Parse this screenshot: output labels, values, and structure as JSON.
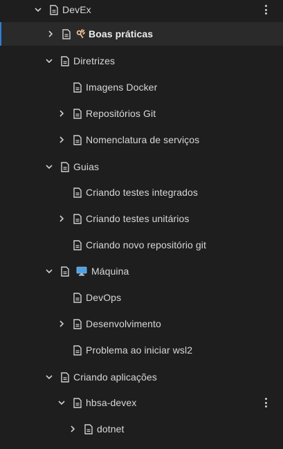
{
  "tree": {
    "items": [
      {
        "label": "DevEx",
        "expanded": true,
        "selected": false,
        "bold": false,
        "emoji": "",
        "more_menu": true
      },
      {
        "label": "Boas práticas",
        "expanded": false,
        "selected": true,
        "bold": true,
        "emoji": "ok-hand",
        "more_menu": false
      },
      {
        "label": "Diretrizes",
        "expanded": true,
        "selected": false,
        "bold": false,
        "emoji": "",
        "more_menu": false
      },
      {
        "label": "Imagens Docker",
        "expanded": null,
        "selected": false,
        "bold": false,
        "emoji": "",
        "more_menu": false
      },
      {
        "label": "Repositórios Git",
        "expanded": false,
        "selected": false,
        "bold": false,
        "emoji": "",
        "more_menu": false
      },
      {
        "label": "Nomenclatura de serviços",
        "expanded": false,
        "selected": false,
        "bold": false,
        "emoji": "",
        "more_menu": false
      },
      {
        "label": "Guias",
        "expanded": true,
        "selected": false,
        "bold": false,
        "emoji": "",
        "more_menu": false
      },
      {
        "label": "Criando testes integrados",
        "expanded": null,
        "selected": false,
        "bold": false,
        "emoji": "",
        "more_menu": false
      },
      {
        "label": "Criando testes unitários",
        "expanded": false,
        "selected": false,
        "bold": false,
        "emoji": "",
        "more_menu": false
      },
      {
        "label": "Criando novo repositório git",
        "expanded": null,
        "selected": false,
        "bold": false,
        "emoji": "",
        "more_menu": false
      },
      {
        "label": "Máquina",
        "expanded": true,
        "selected": false,
        "bold": false,
        "emoji": "desktop-computer",
        "more_menu": false
      },
      {
        "label": "DevOps",
        "expanded": null,
        "selected": false,
        "bold": false,
        "emoji": "",
        "more_menu": false
      },
      {
        "label": "Desenvolvimento",
        "expanded": false,
        "selected": false,
        "bold": false,
        "emoji": "",
        "more_menu": false
      },
      {
        "label": "Problema ao iniciar wsl2",
        "expanded": null,
        "selected": false,
        "bold": false,
        "emoji": "",
        "more_menu": false
      },
      {
        "label": "Criando aplicações",
        "expanded": true,
        "selected": false,
        "bold": false,
        "emoji": "",
        "more_menu": false
      },
      {
        "label": "hbsa-devex",
        "expanded": true,
        "selected": false,
        "bold": false,
        "emoji": "",
        "more_menu": true
      },
      {
        "label": "dotnet",
        "expanded": false,
        "selected": false,
        "bold": false,
        "emoji": "",
        "more_menu": false
      }
    ]
  },
  "colors": {
    "background": "#1e1e1e",
    "text": "#d8d8d8",
    "selected_background": "#2a2a2a",
    "selected_accent": "#2f7fd6",
    "icon": "#d0d0d0"
  }
}
